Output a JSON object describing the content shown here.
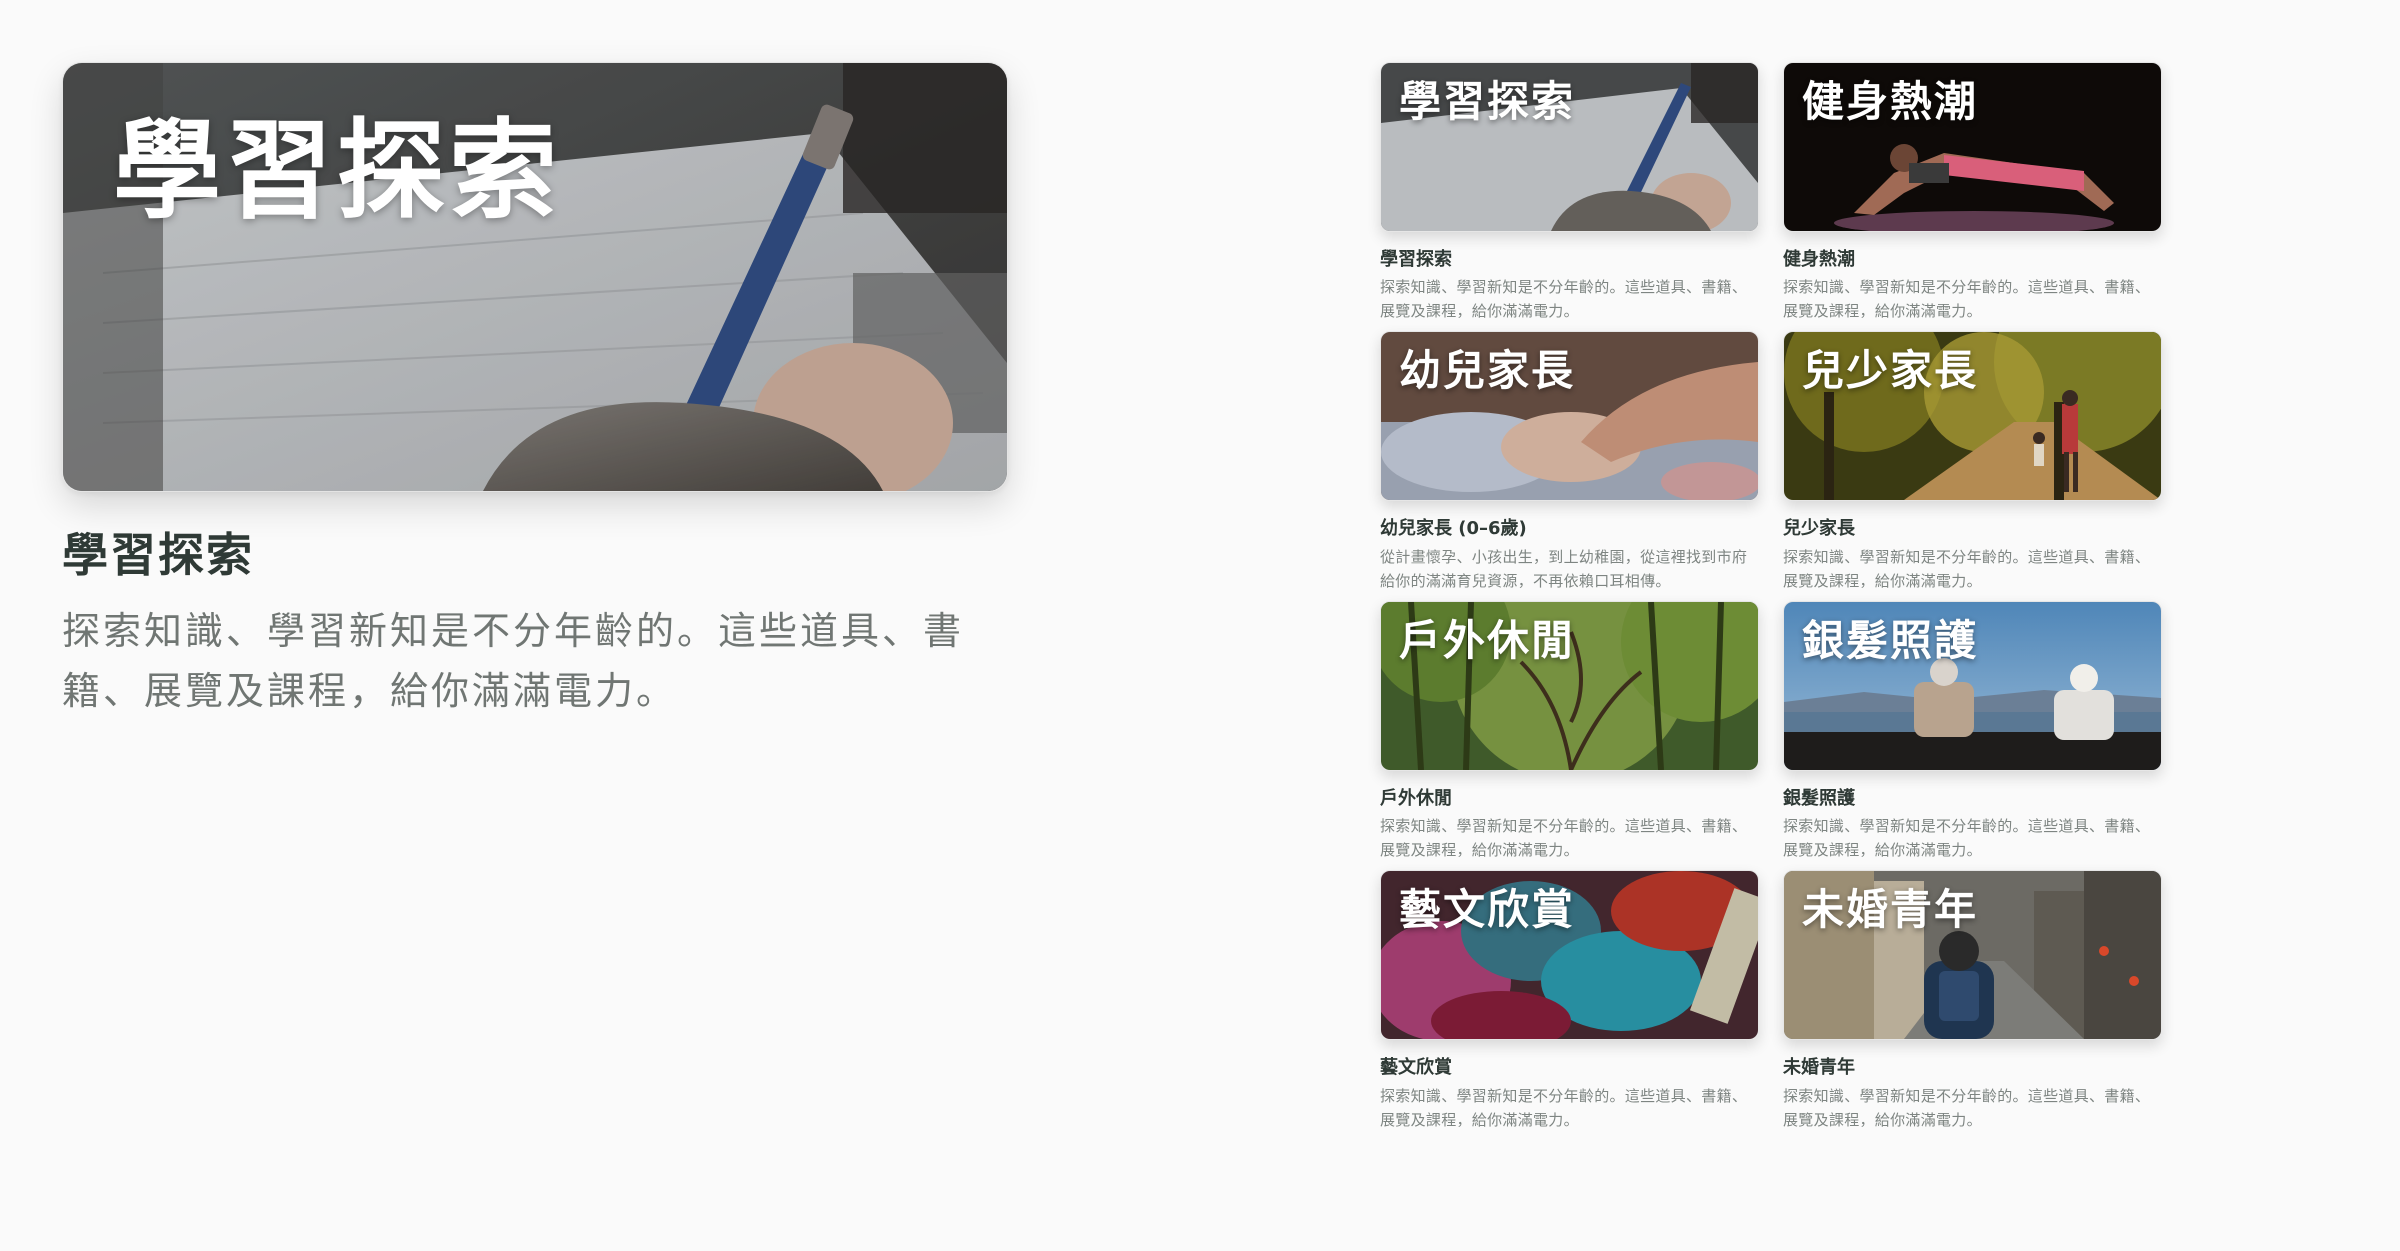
{
  "featured": {
    "overlay_title": "學習探索",
    "heading": "學習探索",
    "description": "探索知識、學習新知是不分年齡的。這些道具、書籍、展覽及課程，給你滿滿電力。"
  },
  "cards": [
    {
      "overlay": "學習探索",
      "title": "學習探索",
      "desc": "探索知識、學習新知是不分年齡的。這些道具、書籍、展覽及課程，給你滿滿電力。"
    },
    {
      "overlay": "健身熱潮",
      "title": "健身熱潮",
      "desc": "探索知識、學習新知是不分年齡的。這些道具、書籍、展覽及課程，給你滿滿電力。"
    },
    {
      "overlay": "幼兒家長",
      "title": "幼兒家長 (0–6歲)",
      "desc": "從計畫懷孕、小孩出生，到上幼稚園，從這裡找到市府給你的滿滿育兒資源，不再依賴口耳相傳。"
    },
    {
      "overlay": "兒少家長",
      "title": "兒少家長",
      "desc": "探索知識、學習新知是不分年齡的。這些道具、書籍、展覽及課程，給你滿滿電力。"
    },
    {
      "overlay": "戶外休閒",
      "title": "戶外休閒",
      "desc": "探索知識、學習新知是不分年齡的。這些道具、書籍、展覽及課程，給你滿滿電力。"
    },
    {
      "overlay": "銀髮照護",
      "title": "銀髮照護",
      "desc": "探索知識、學習新知是不分年齡的。這些道具、書籍、展覽及課程，給你滿滿電力。"
    },
    {
      "overlay": "藝文欣賞",
      "title": "藝文欣賞",
      "desc": "探索知識、學習新知是不分年齡的。這些道具、書籍、展覽及課程，給你滿滿電力。"
    },
    {
      "overlay": "未婚青年",
      "title": "未婚青年",
      "desc": "探索知識、學習新知是不分年齡的。這些道具、書籍、展覽及課程，給你滿滿電力。"
    }
  ]
}
